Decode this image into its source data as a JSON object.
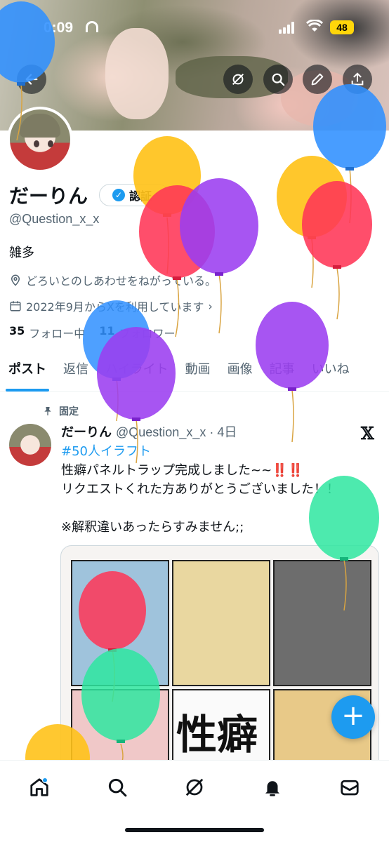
{
  "status_bar": {
    "time": "0:09",
    "battery": "48"
  },
  "profile": {
    "display_name": "だーりん",
    "verify_label": "認証",
    "handle": "@Question_x_x",
    "bio": "雑多",
    "location": "どろいとのしあわせをねがっている。",
    "joined": "2022年9月からXを利用しています",
    "following_count": "35",
    "following_label": "フォロー中",
    "followers_count": "11",
    "followers_label": "フォロワー"
  },
  "tabs": [
    "ポスト",
    "返信",
    "ハイライト",
    "動画",
    "画像",
    "記事",
    "いいね"
  ],
  "active_tab": "ポスト",
  "post": {
    "pinned_label": "固定",
    "name": "だーりん",
    "handle_time": "@Question_x_x · 4日",
    "hashtag": "#50人イラフト",
    "line1": "性癖パネルトラップ完成しました~~",
    "bang": "‼️‼️",
    "line2": "リクエストくれた方ありがとうございました！！",
    "line3": "※解釈違いあったらすみません;;",
    "image_title": "性癖"
  },
  "fab_label": "+",
  "nav": [
    "home-icon",
    "search-icon",
    "grok-icon",
    "notifications-icon",
    "messages-icon"
  ],
  "colors": {
    "accent": "#1d9bf0",
    "text": "#0f1419",
    "muted": "#536471"
  }
}
